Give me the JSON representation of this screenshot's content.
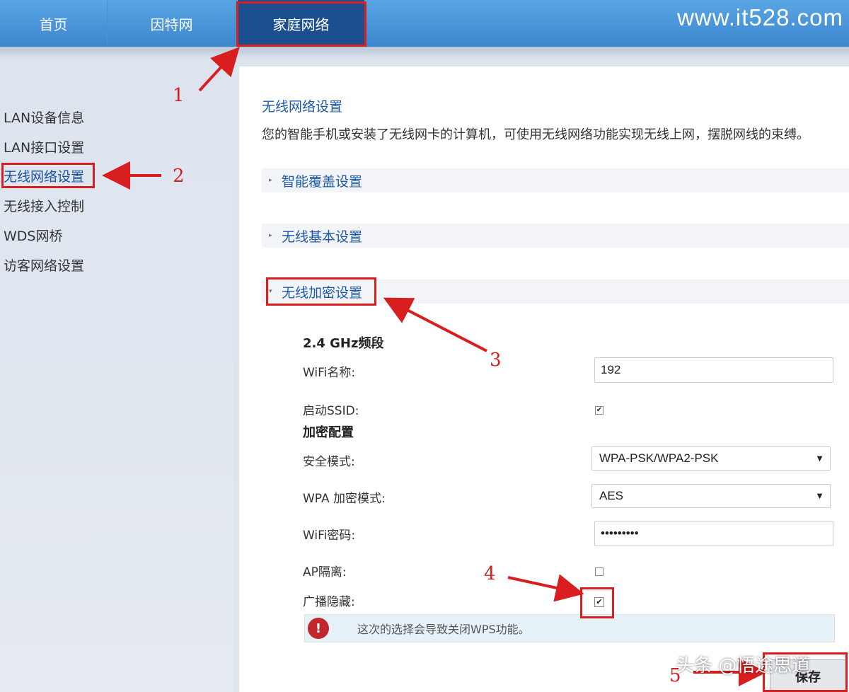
{
  "topnav": {
    "tabs": [
      {
        "label": "首页"
      },
      {
        "label": "因特网"
      },
      {
        "label": "家庭网络"
      }
    ],
    "brand": "www.it528.com"
  },
  "sidebar": {
    "items": [
      {
        "label": "LAN设备信息"
      },
      {
        "label": "LAN接口设置"
      },
      {
        "label": "无线网络设置"
      },
      {
        "label": "无线接入控制"
      },
      {
        "label": "WDS网桥"
      },
      {
        "label": "访客网络设置"
      }
    ]
  },
  "main": {
    "title": "无线网络设置",
    "description": "您的智能手机或安装了无线网卡的计算机，可使用无线网络功能实现无线上网，摆脱网线的束缚。",
    "sections": [
      {
        "label": "智能覆盖设置",
        "caret": "▸"
      },
      {
        "label": "无线基本设置",
        "caret": "▸"
      },
      {
        "label": "无线加密设置",
        "caret": "▾"
      }
    ],
    "form": {
      "band_heading": "2.4 GHz频段",
      "wifi_name_label": "WiFi名称:",
      "wifi_name_value": "192",
      "ssid_label": "启动SSID:",
      "ssid_checked": "✔",
      "encrypt_heading": "加密配置",
      "security_mode_label": "安全模式:",
      "security_mode_value": "WPA-PSK/WPA2-PSK",
      "wpa_mode_label": "WPA 加密模式:",
      "wpa_mode_value": "AES",
      "password_label": "WiFi密码:",
      "password_value": "•••••••••",
      "ap_isolation_label": "AP隔离:",
      "broadcast_hide_label": "广播隐藏:",
      "broadcast_hide_checked": "✔",
      "dropdown_arrow": "▼"
    },
    "warning": {
      "icon": "!",
      "text": "这次的选择会导致关闭WPS功能。"
    },
    "save_label": "保存"
  },
  "annotations": {
    "numbers": [
      "1",
      "2",
      "3",
      "4",
      "5"
    ],
    "color": "#d81e1e"
  },
  "watermark": "头条 @悟途思道"
}
